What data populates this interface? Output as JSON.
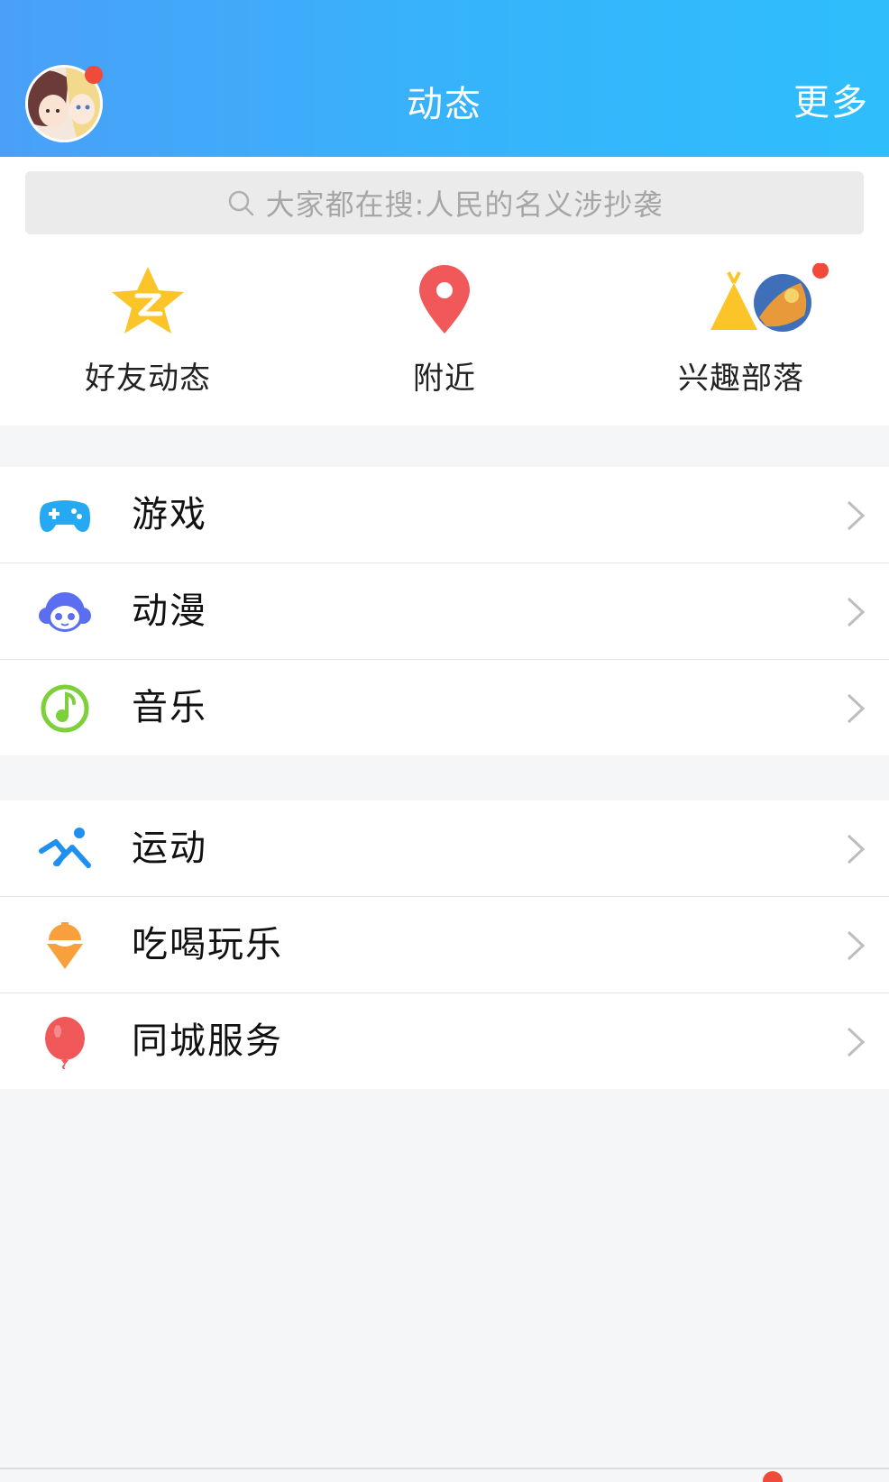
{
  "header": {
    "title": "动态",
    "more_label": "更多"
  },
  "search": {
    "text": "大家都在搜:人民的名义涉抄袭"
  },
  "quick_entries": [
    {
      "label": "好友动态",
      "icon": "star-z-icon"
    },
    {
      "label": "附近",
      "icon": "location-pin-icon"
    },
    {
      "label": "兴趣部落",
      "icon": "tribe-tent-icon"
    }
  ],
  "groups": [
    {
      "items": [
        {
          "label": "游戏",
          "icon": "gamepad-icon"
        },
        {
          "label": "动漫",
          "icon": "anime-face-icon"
        },
        {
          "label": "音乐",
          "icon": "music-note-icon"
        }
      ]
    },
    {
      "items": [
        {
          "label": "运动",
          "icon": "running-icon"
        },
        {
          "label": "吃喝玩乐",
          "icon": "ice-cream-icon"
        },
        {
          "label": "同城服务",
          "icon": "balloon-icon"
        }
      ]
    }
  ],
  "colors": {
    "header_gradient_start": "#4aa0f7",
    "header_gradient_end": "#2ebefc",
    "badge_red": "#f04a3a",
    "star_yellow": "#fbc52a",
    "pin_red": "#f0585a",
    "game_blue": "#25a9f2",
    "anime_purple": "#5b6ef0",
    "music_green": "#7cd13a",
    "sport_blue": "#1f8ff0",
    "food_orange": "#f7a03c",
    "balloon_red": "#f0585a",
    "background": "#f5f6f8"
  }
}
